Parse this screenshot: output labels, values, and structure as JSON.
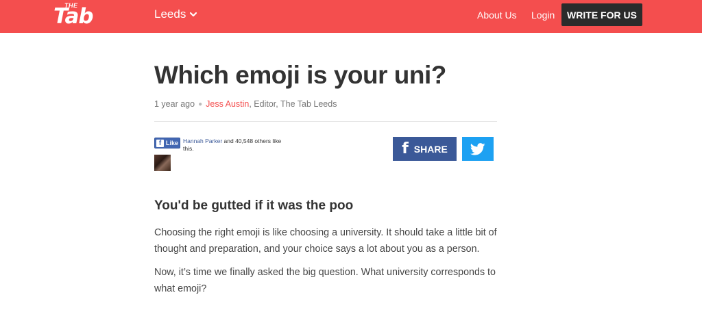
{
  "header": {
    "logo_small": "THE",
    "logo_main": "Tab",
    "city": "Leeds",
    "nav": {
      "about": "About Us",
      "login": "Login",
      "write": "WRITE FOR US"
    },
    "colors": {
      "brand": "#f44e4e",
      "write_button": "#2b2b2b"
    }
  },
  "article": {
    "title": "Which emoji is your uni?",
    "meta": {
      "time": "1 year ago",
      "author": "Jess Austin",
      "role": ", Editor, The Tab Leeds"
    },
    "social": {
      "like_label": "Like",
      "like_friend": "Hannah Parker",
      "like_rest": " and 40,548 others like this.",
      "share_label": "SHARE",
      "colors": {
        "facebook": "#3b5998",
        "twitter": "#1da1f2"
      }
    },
    "subheading": "You'd be gutted if it was the poo",
    "paragraphs": [
      "Choosing the right emoji is like choosing a university. It should take a little bit of thought and preparation, and your choice says a lot about you as a person.",
      "Now, it’s time we finally asked the big question. What university corresponds to what emoji?"
    ]
  }
}
